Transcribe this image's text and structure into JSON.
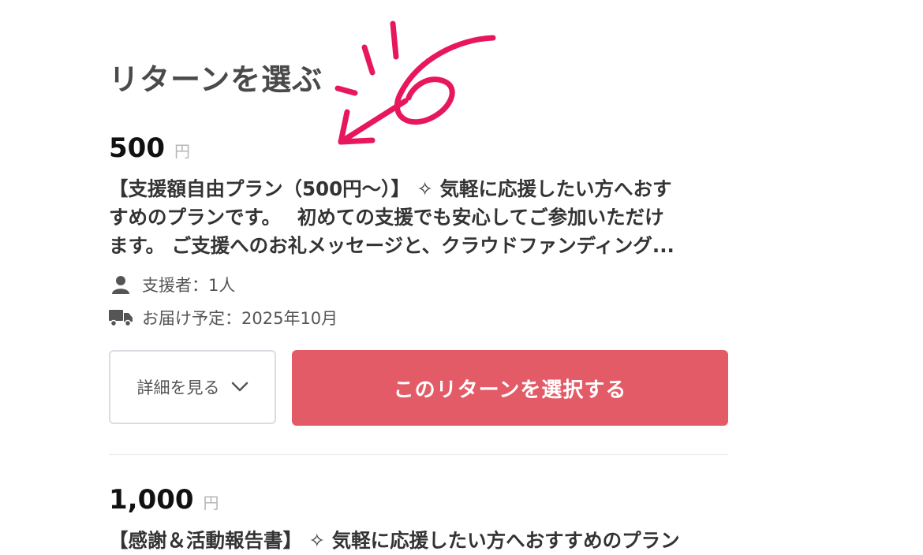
{
  "section": {
    "heading": "リターンを選ぶ"
  },
  "annotation": {
    "color": "#e8175d",
    "mark": "6"
  },
  "rewards": [
    {
      "price": "500",
      "unit": "円",
      "description_lines": [
        "【支援額自由プラン（500円〜）】 ✧ 気軽に応援したい方へおす",
        "すめのプランです。　 初めての支援でも安心してご参加いただけ",
        "ます。 ご支援へのお礼メッセージと、クラウドファンディング..."
      ],
      "supporters": "支援者：1人",
      "delivery": "お届け予定：2025年10月",
      "detail_button": "詳細を見る",
      "select_button": "このリターンを選択する"
    },
    {
      "price": "1,000",
      "unit": "円",
      "description_lines": [
        "【感謝＆活動報告書】 ✧ 気軽に応援したい方へおすすめのプラン"
      ]
    }
  ],
  "icons": {
    "supporters": "person-icon",
    "delivery": "truck-icon",
    "detail": "chevron-down-icon"
  },
  "colors": {
    "primary_button": "#e35b67",
    "heading": "#4a4a4a"
  }
}
